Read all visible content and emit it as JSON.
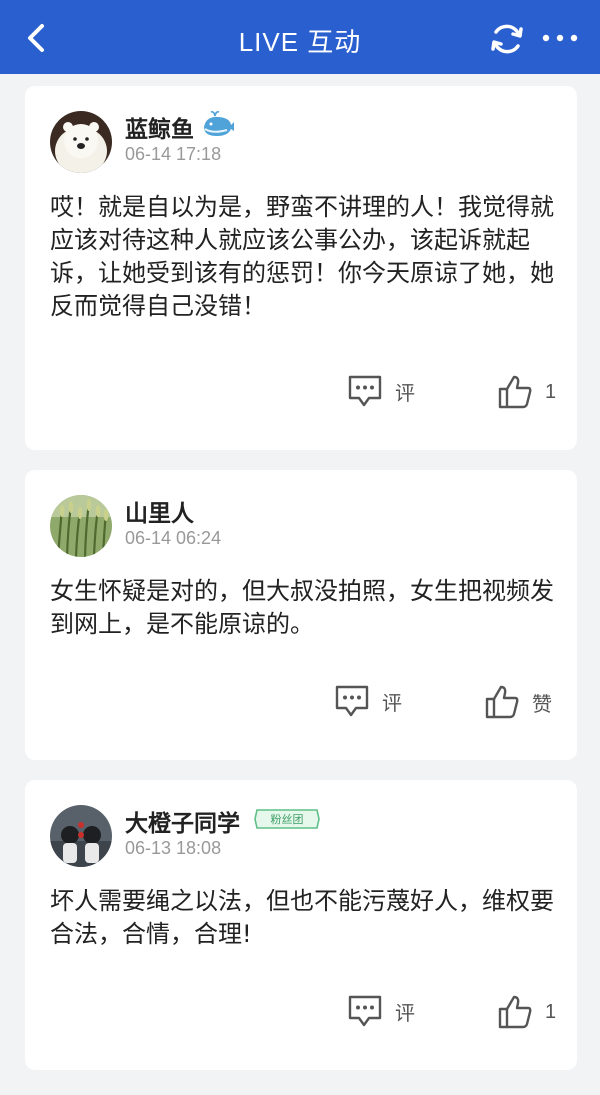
{
  "header": {
    "title": "LIVE 互动",
    "back_icon": "back-icon",
    "refresh_icon": "refresh-icon",
    "more_icon": "more-icon",
    "bg_color": "#2a5fd0"
  },
  "comments": [
    {
      "author": "蓝鲸鱼",
      "badge": "whale-icon",
      "time": "06-14 17:18",
      "text": "哎！就是自以为是，野蛮不讲理的人！我觉得就应该对待这种人就应该公事公办，该起诉就起诉，让她受到该有的惩罚！你今天原谅了她，她反而觉得自己没错！",
      "reply_label": "评",
      "like_label": "1"
    },
    {
      "author": "山里人",
      "time": "06-14 06:24",
      "text": "女生怀疑是对的，但大叔没拍照，女生把视频发到网上，是不能原谅的。",
      "reply_label": "评",
      "like_label": "赞"
    },
    {
      "author": "大橙子同学",
      "badge": "fan-club-badge",
      "badge_text": "粉丝团",
      "time": "06-13 18:08",
      "text": "坏人需要绳之以法，但也不能污蔑好人，维权要合法，合情，合理!",
      "reply_label": "评",
      "like_label": "1"
    }
  ]
}
